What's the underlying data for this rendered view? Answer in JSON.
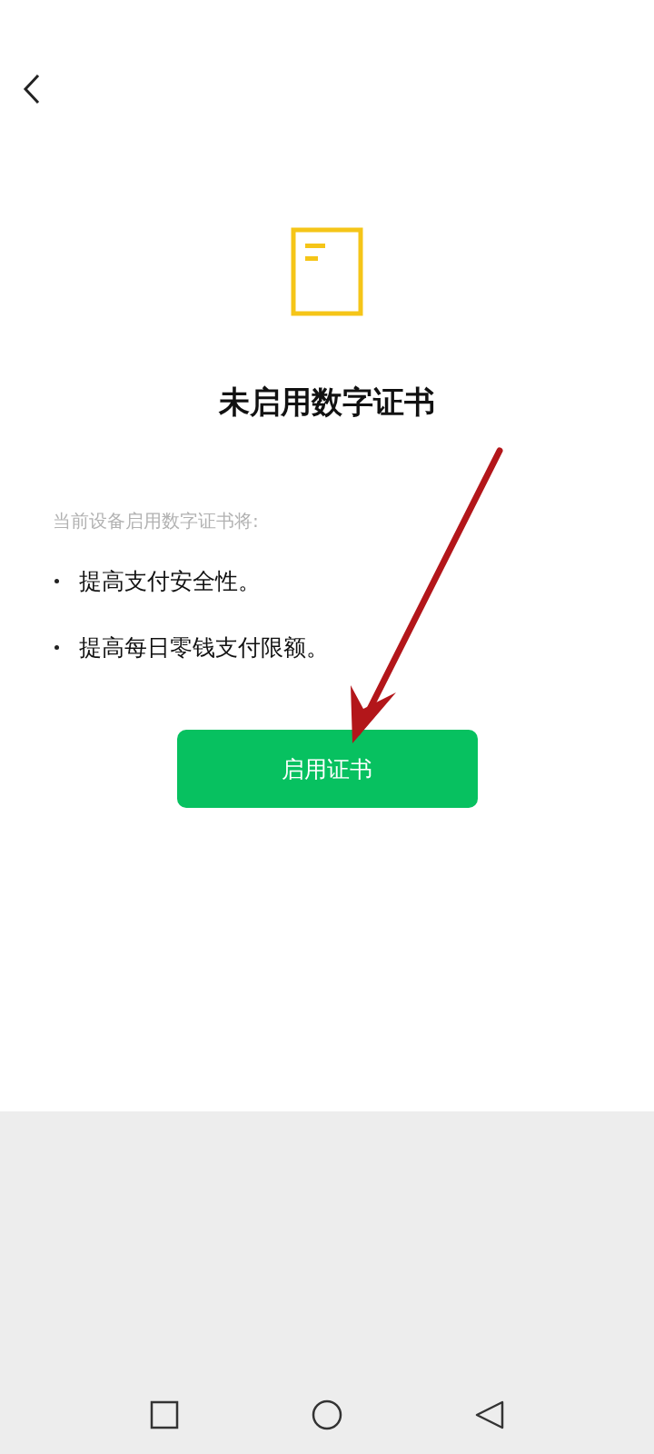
{
  "title": "未启用数字证书",
  "intro": "当前设备启用数字证书将:",
  "benefits": [
    "提高支付安全性。",
    "提高每日零钱支付限额。"
  ],
  "button": {
    "label": "启用证书"
  }
}
